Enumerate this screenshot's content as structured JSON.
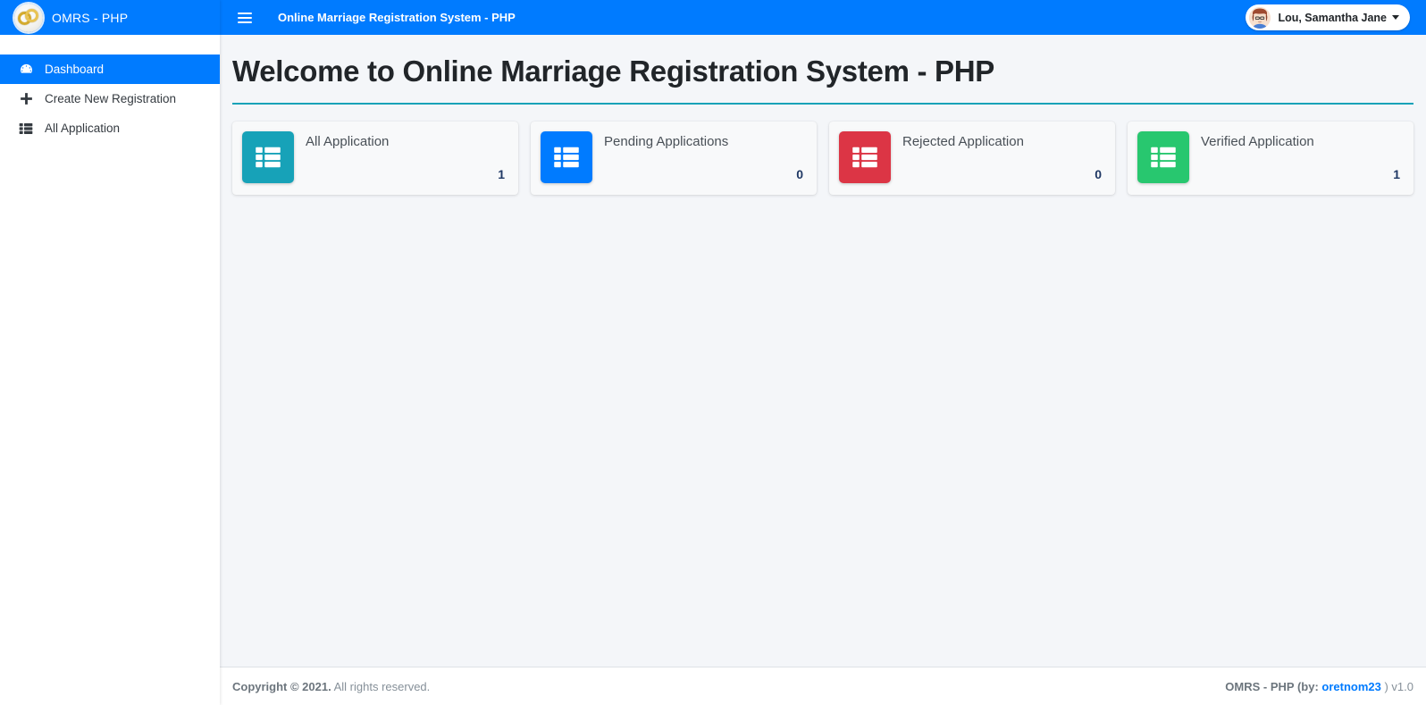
{
  "brand": {
    "logo_icon": "wedding-rings-icon",
    "title": "OMRS - PHP"
  },
  "sidebar": {
    "items": [
      {
        "label": "Dashboard",
        "icon": "tachometer-icon",
        "active": true
      },
      {
        "label": "Create New Registration",
        "icon": "plus-icon",
        "active": false
      },
      {
        "label": "All Application",
        "icon": "th-list-icon",
        "active": false
      }
    ]
  },
  "navbar": {
    "menu_icon": "hamburger-icon",
    "title": "Online Marriage Registration System - PHP",
    "user": {
      "avatar_icon": "user-avatar",
      "name": "Lou, Samantha Jane",
      "caret_icon": "caret-down-icon"
    }
  },
  "main": {
    "page_title": "Welcome to Online Marriage Registration System - PHP",
    "rule_color": "#17a2b8",
    "cards": [
      {
        "label": "All Application",
        "count": "1",
        "color": "#17a2b8",
        "icon": "th-list-icon"
      },
      {
        "label": "Pending Applications",
        "count": "0",
        "color": "#007bff",
        "icon": "th-list-icon"
      },
      {
        "label": "Rejected Application",
        "count": "0",
        "color": "#dc3545",
        "icon": "th-list-icon"
      },
      {
        "label": "Verified Application",
        "count": "1",
        "color": "#28c76f",
        "icon": "th-list-icon"
      }
    ]
  },
  "footer": {
    "copyright_strong": "Copyright © 2021.",
    "copyright_rest": " All rights reserved.",
    "version_prefix": "OMRS - PHP (by: ",
    "version_link": "oretnom23",
    "version_suffix": " ) v1.0"
  }
}
